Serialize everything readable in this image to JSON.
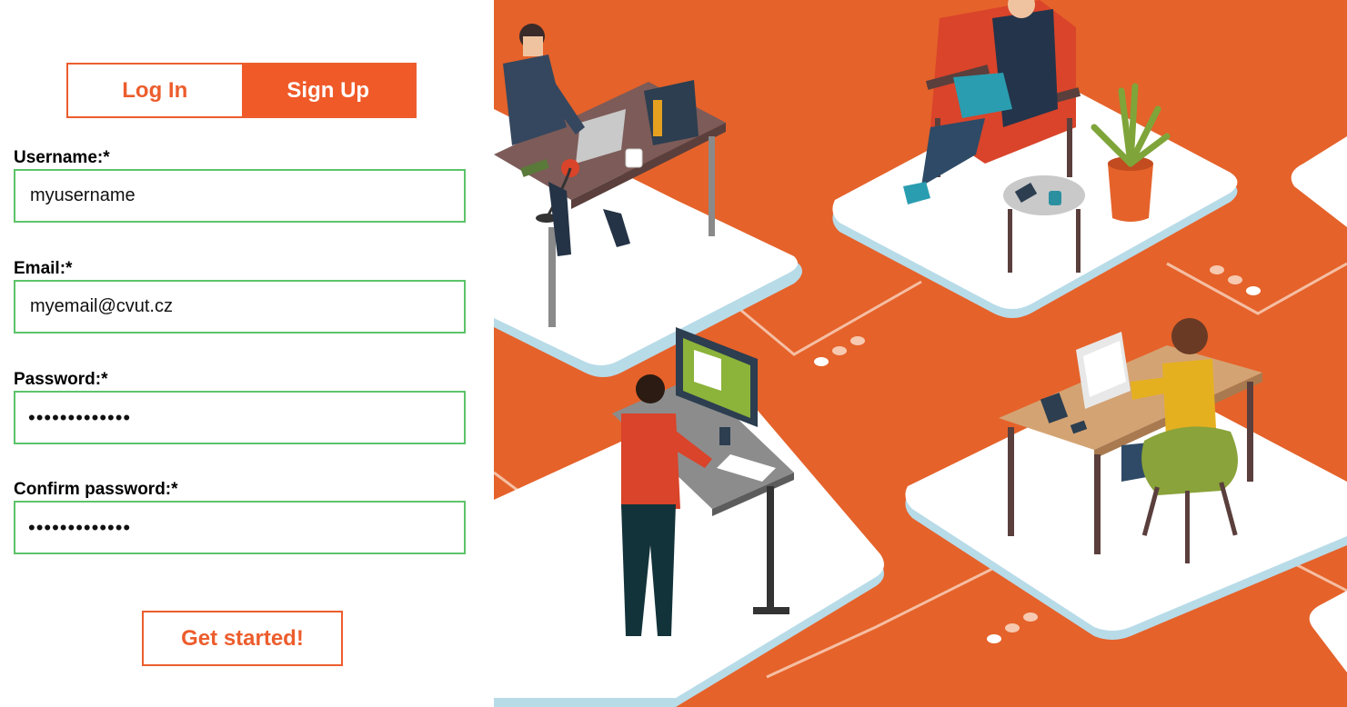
{
  "tabs": {
    "login_label": "Log In",
    "signup_label": "Sign Up",
    "active": "signup"
  },
  "form": {
    "username": {
      "label": "Username:*",
      "value": "myusername"
    },
    "email": {
      "label": "Email:*",
      "value": "myemail@cvut.cz"
    },
    "password": {
      "label": "Password:*",
      "value": "•••••••••••••"
    },
    "confirm_password": {
      "label": "Confirm password:*",
      "value": "•••••••••••••"
    },
    "submit_label": "Get started!"
  },
  "colors": {
    "accent": "#f05a28",
    "field_border": "#5cc46a",
    "illustration_bg": "#e5622a"
  },
  "illustration": {
    "subject": "isometric-coworking-office"
  }
}
